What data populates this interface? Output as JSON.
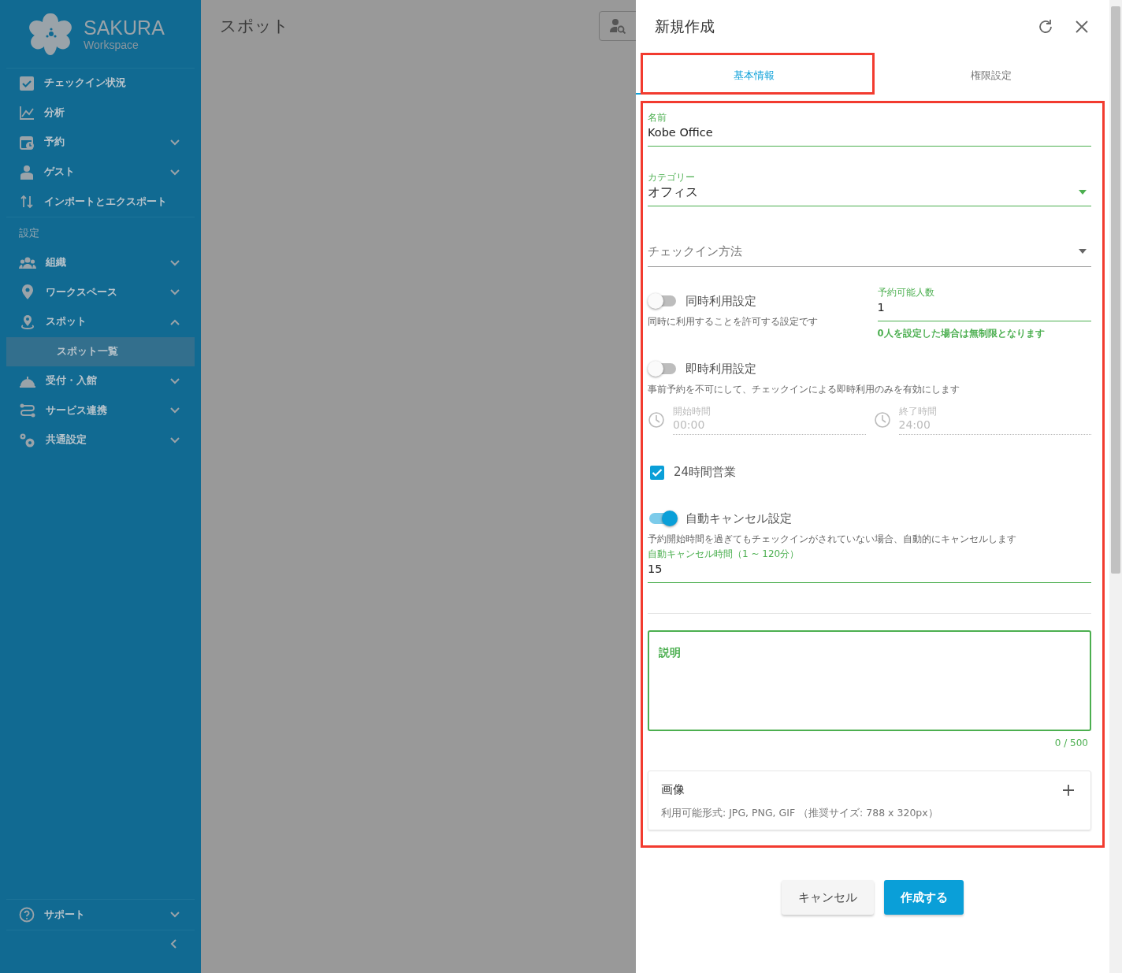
{
  "sidebar": {
    "logo": {
      "title": "SAKURA",
      "subtitle": "Workspace"
    },
    "items": [
      {
        "label": "チェックイン状況",
        "kind": "link"
      },
      {
        "label": "分析",
        "kind": "link"
      },
      {
        "label": "予約",
        "kind": "group",
        "expanded": false
      },
      {
        "label": "ゲスト",
        "kind": "group",
        "expanded": false
      },
      {
        "label": "インポートとエクスポート",
        "kind": "link"
      }
    ],
    "section_label": "設定",
    "settings_items": [
      {
        "label": "組織",
        "kind": "group",
        "expanded": false
      },
      {
        "label": "ワークスペース",
        "kind": "group",
        "expanded": false
      },
      {
        "label": "スポット",
        "kind": "group",
        "expanded": true,
        "children": [
          {
            "label": "スポット一覧",
            "selected": true
          }
        ]
      },
      {
        "label": "受付・入館",
        "kind": "group",
        "expanded": false
      },
      {
        "label": "サービス連携",
        "kind": "group",
        "expanded": false
      },
      {
        "label": "共通設定",
        "kind": "group",
        "expanded": false
      }
    ],
    "footer_items": [
      {
        "label": "サポート",
        "kind": "group",
        "expanded": false
      }
    ]
  },
  "main": {
    "page_title": "スポット"
  },
  "drawer": {
    "title": "新規作成",
    "tabs": [
      {
        "label": "基本情報",
        "selected": true
      },
      {
        "label": "権限設定",
        "selected": false
      }
    ],
    "name": {
      "label": "名前",
      "value": "Kobe Office"
    },
    "category": {
      "label": "カテゴリー",
      "value": "オフィス"
    },
    "checkin_method": {
      "placeholder": "チェックイン方法"
    },
    "concurrent": {
      "label": "同時利用設定",
      "on": false,
      "description": "同時に利用することを許可する設定です"
    },
    "capacity": {
      "label": "予約可能人数",
      "value": "1",
      "hint": "0人を設定した場合は無制限となります"
    },
    "instant": {
      "label": "即時利用設定",
      "on": false,
      "description": "事前予約を不可にして、チェックインによる即時利用のみを有効にします"
    },
    "times": [
      {
        "label": "開始時間",
        "value": "00:00",
        "disabled": true
      },
      {
        "label": "終了時間",
        "value": "24:00",
        "disabled": true
      }
    ],
    "open_24h": {
      "label": "24時間営業",
      "checked": true
    },
    "auto_cancel": {
      "label": "自動キャンセル設定",
      "on": true,
      "description": "予約開始時間を過ぎてもチェックインがされていない場合、自動的にキャンセルします"
    },
    "auto_cancel_minutes": {
      "label": "自動キャンセル時間（1 ~ 120分）",
      "value": "15"
    },
    "description": {
      "label": "説明",
      "focused": true,
      "counter": "0 / 500"
    },
    "image": {
      "title": "画像",
      "note": "利用可能形式: JPG, PNG, GIF （推奨サイズ: 788 x 320px）"
    },
    "buttons": [
      {
        "label": "キャンセル",
        "kind": "secondary"
      },
      {
        "label": "作成する",
        "kind": "primary"
      }
    ]
  }
}
